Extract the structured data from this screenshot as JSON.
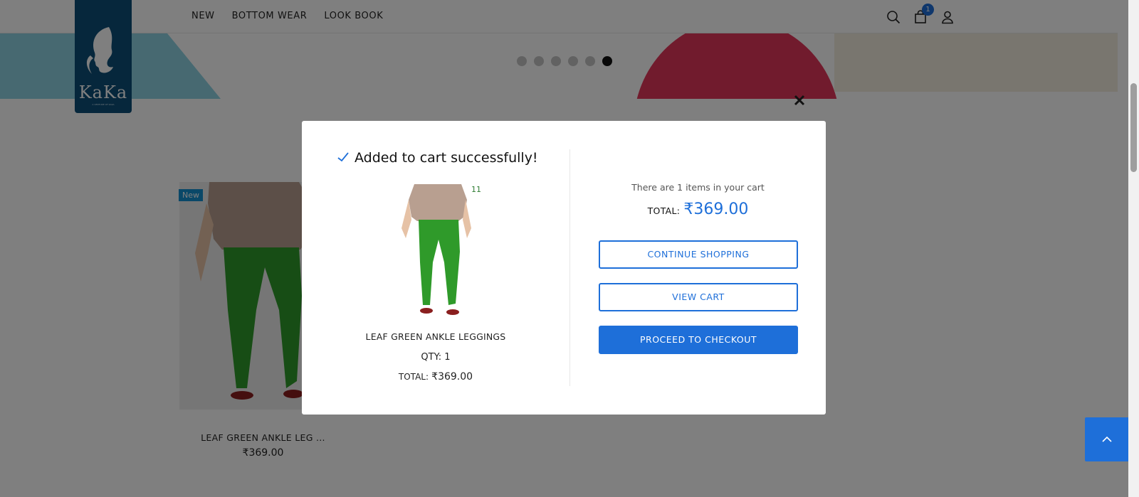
{
  "header": {
    "logo_text": "KaKa",
    "logo_tagline": "A VENTURE OF KAKA",
    "nav": [
      "NEW",
      "BOTTOM WEAR",
      "LOOK BOOK"
    ],
    "cart_count": "1",
    "icons": [
      "search-icon",
      "bag-icon",
      "user-icon"
    ]
  },
  "carousel": {
    "slide_count": 6,
    "active_index": 5
  },
  "product_card": {
    "tag": "New",
    "name": "LEAF GREEN ANKLE LEG ...",
    "price": "₹369.00"
  },
  "modal": {
    "title": "Added to cart successfully!",
    "size_label": "11",
    "product_name": "LEAF GREEN ANKLE LEGGINGS",
    "qty": "QTY: 1",
    "total_label": "TOTAL:",
    "total_value": "₹369.00",
    "cart_count_text": "There are 1 items in your cart",
    "grand_total_label": "TOTAL:",
    "grand_total_value": "₹369.00",
    "continue_label": "CONTINUE SHOPPING",
    "view_cart_label": "VIEW CART",
    "checkout_label": "PROCEED TO CHECKOUT"
  },
  "colors": {
    "accent": "#1e6fd9",
    "logo_bg": "#0c4f78",
    "legging_green": "#2f9a2a",
    "overlay": "rgba(0,0,0,0.5)"
  }
}
